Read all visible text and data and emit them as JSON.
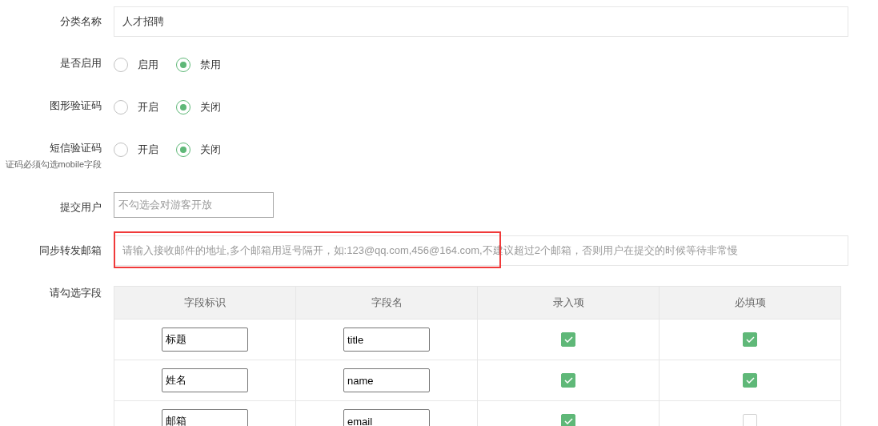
{
  "form": {
    "category_name": {
      "label": "分类名称",
      "value": "人才招聘"
    },
    "radio_rows": [
      {
        "label": "是否启用",
        "options": [
          {
            "label": "启用",
            "selected": false
          },
          {
            "label": "禁用",
            "selected": true
          }
        ]
      },
      {
        "label": "图形验证码",
        "options": [
          {
            "label": "开启",
            "selected": false
          },
          {
            "label": "关闭",
            "selected": true
          }
        ]
      },
      {
        "label": "短信验证码",
        "hint": "证码必须勾选mobile字段",
        "options": [
          {
            "label": "开启",
            "selected": false
          },
          {
            "label": "关闭",
            "selected": true
          }
        ]
      }
    ],
    "submit_user": {
      "label": "提交用户",
      "placeholder": "不勾选会对游客开放"
    },
    "forward_email": {
      "label": "同步转发邮箱",
      "placeholder": "请输入接收邮件的地址,多个邮箱用逗号隔开，如:123@qq.com,456@164.com,不建议超过2个邮箱，否则用户在提交的时候等待非常慢",
      "highlighted": true
    },
    "fields": {
      "label": "请勾选字段",
      "columns": [
        "字段标识",
        "字段名",
        "录入项",
        "必填项"
      ],
      "rows": [
        {
          "title": "标题",
          "name": "title",
          "input": true,
          "required": true
        },
        {
          "title": "姓名",
          "name": "name",
          "input": true,
          "required": true
        },
        {
          "title": "邮箱",
          "name": "email",
          "input": true,
          "required": false
        }
      ]
    }
  }
}
